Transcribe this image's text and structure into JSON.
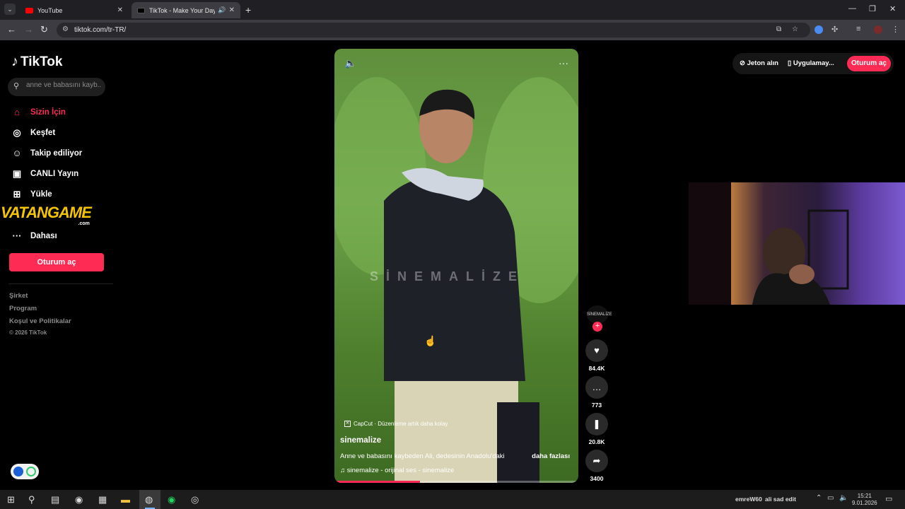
{
  "browser": {
    "tabs": [
      {
        "title": "YouTube",
        "favicon_color": "#ff0000"
      },
      {
        "title": "TikTok - Make Your Day",
        "favicon_color": "#000000"
      }
    ],
    "url": "tiktok.com/tr-TR/"
  },
  "sidebar": {
    "logo": "TikTok",
    "search_placeholder": "anne ve babasını kayb...",
    "nav": [
      {
        "label": "Sizin İçin",
        "icon": "home-icon",
        "active": true
      },
      {
        "label": "Keşfet",
        "icon": "compass-icon"
      },
      {
        "label": "Takip ediliyor",
        "icon": "following-icon"
      },
      {
        "label": "CANLI Yayın",
        "icon": "live-icon"
      },
      {
        "label": "Yükle",
        "icon": "upload-icon"
      },
      {
        "label": "Dahası",
        "icon": "more-icon"
      }
    ],
    "login_button": "Oturum aç",
    "footer_links": [
      "Şirket",
      "Program",
      "Koşul ve Politikalar"
    ],
    "copyright": "© 2026 TikTok"
  },
  "overlay_watermark": {
    "brand": "VATANGAME",
    "suffix": ".com"
  },
  "video": {
    "watermark": "SİNEMALİZE",
    "capcut": "CapCut · Düzenleme artık daha kolay",
    "author": "sinemalize",
    "description": "Anne ve babasını kaybeden Ali, dedesinin Anadolu'daki",
    "more": "daha fazlası",
    "music": "sinemalize - orijinal ses - sinemalize",
    "progress": 0.35,
    "creator_avatar_text": "SİNEMALİZE"
  },
  "actions": [
    {
      "icon": "heart-icon",
      "count": "84.4K"
    },
    {
      "icon": "comment-icon",
      "count": "773"
    },
    {
      "icon": "bookmark-icon",
      "count": "20.8K"
    },
    {
      "icon": "share-icon",
      "count": "3400"
    }
  ],
  "topright": {
    "coins": "Jeton alın",
    "app": "Uygulamay...",
    "login": "Oturum aç"
  },
  "taskbar": {
    "user": "emreW60",
    "status": "ali sad edit",
    "time": "15:21",
    "date": "9.01.2026"
  },
  "colors": {
    "accent": "#fe2c55"
  }
}
